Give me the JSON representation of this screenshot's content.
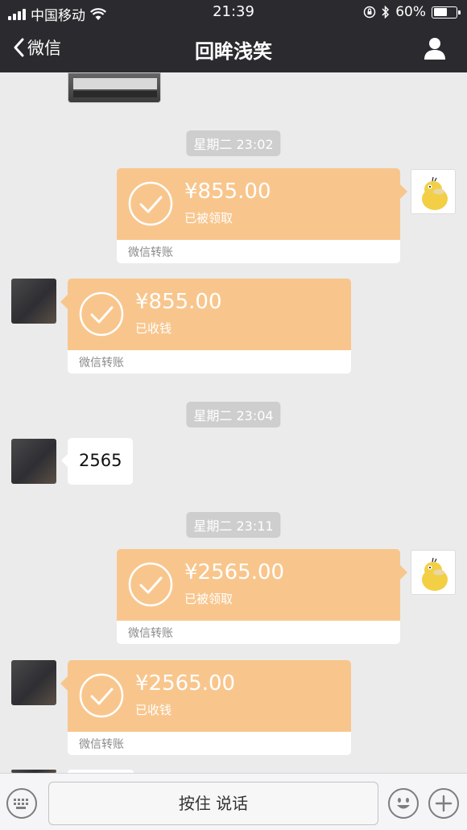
{
  "status_bar": {
    "carrier": "中国移动",
    "time": "21:39",
    "battery": "60%"
  },
  "nav": {
    "back_label": "微信",
    "title": "回眸浅笑"
  },
  "messages": [
    {
      "type": "timestamp",
      "text": "星期二 23:02"
    },
    {
      "type": "transfer",
      "side": "right",
      "amount": "¥855.00",
      "status": "已被领取",
      "footer": "微信转账"
    },
    {
      "type": "transfer",
      "side": "left",
      "amount": "¥855.00",
      "status": "已收钱",
      "footer": "微信转账"
    },
    {
      "type": "timestamp",
      "text": "星期二 23:04"
    },
    {
      "type": "text",
      "side": "left",
      "text": "2565"
    },
    {
      "type": "timestamp",
      "text": "星期二 23:11"
    },
    {
      "type": "transfer",
      "side": "right",
      "amount": "¥2565.00",
      "status": "已被领取",
      "footer": "微信转账"
    },
    {
      "type": "transfer",
      "side": "left",
      "amount": "¥2565.00",
      "status": "已收钱",
      "footer": "微信转账"
    }
  ],
  "input_bar": {
    "talk_label": "按住 说话"
  },
  "colors": {
    "nav_bg": "#2b2b2f",
    "chat_bg": "#ebebeb",
    "transfer_orange": "#f8c68d"
  }
}
